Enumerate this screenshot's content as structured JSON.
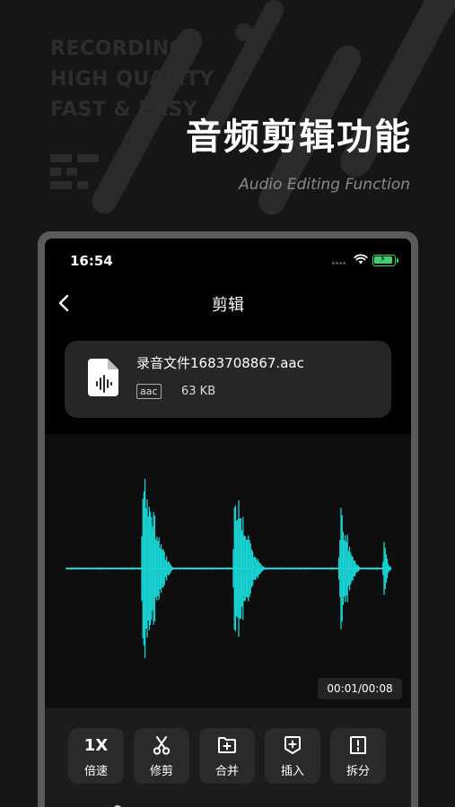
{
  "promo": {
    "taglines": [
      "RECORDING",
      "HIGH QUALITY",
      "FAST & EASY"
    ],
    "title": "音频剪辑功能",
    "subtitle": "Audio Editing Function"
  },
  "status_bar": {
    "time": "16:54",
    "battery_state": "charging"
  },
  "nav": {
    "back_icon": "chevron-left-icon",
    "title": "剪辑"
  },
  "file": {
    "icon": "audio-file-icon",
    "name": "录音文件1683708867.aac",
    "format": "aac",
    "size": "63 KB"
  },
  "playback": {
    "position": "00:01/00:08",
    "waveform_color": "#19d3d3"
  },
  "tools": [
    {
      "icon_text": "1X",
      "label": "倍速",
      "icon": "speed-icon"
    },
    {
      "icon": "scissors-icon",
      "label": "修剪"
    },
    {
      "icon": "folder-plus-icon",
      "label": "合并"
    },
    {
      "icon": "insert-plus-icon",
      "label": "插入"
    },
    {
      "icon": "split-icon",
      "label": "拆分"
    }
  ],
  "colors": {
    "accent": "#19d3d3",
    "battery": "#3fd06a",
    "card_bg": "#262626"
  }
}
